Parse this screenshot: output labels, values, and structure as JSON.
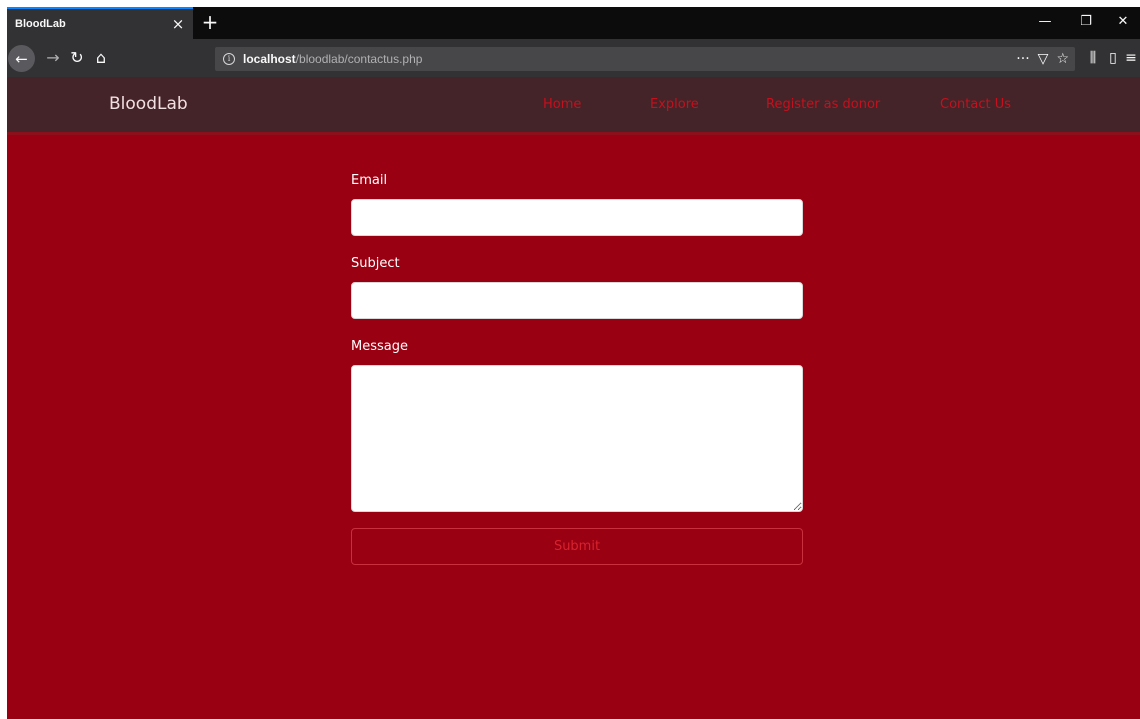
{
  "browser": {
    "tab_title": "BloodLab",
    "tab_close_glyph": "×",
    "new_tab_glyph": "+",
    "url_host": "localhost",
    "url_path": "/bloodlab/contactus.php",
    "icons": {
      "back": "←",
      "forward": "→",
      "reload": "↻",
      "home": "⌂",
      "info": "i",
      "more": "···",
      "pocket": "▽",
      "bookmark": "☆",
      "library": "⫼",
      "sidebar": "▯",
      "menu": "≡",
      "minimize": "—",
      "restore": "❐",
      "close": "✕"
    }
  },
  "site": {
    "brand": "BloodLab",
    "nav": [
      {
        "label": "Home"
      },
      {
        "label": "Explore"
      },
      {
        "label": "Register as donor"
      },
      {
        "label": "Contact Us"
      }
    ],
    "colors": {
      "page_bg": "#990011",
      "nav_bg": "#442428",
      "nav_link": "#c6101d"
    }
  },
  "form": {
    "email_label": "Email",
    "email_value": "",
    "subject_label": "Subject",
    "subject_value": "",
    "message_label": "Message",
    "message_value": "",
    "submit_label": "Submit"
  }
}
